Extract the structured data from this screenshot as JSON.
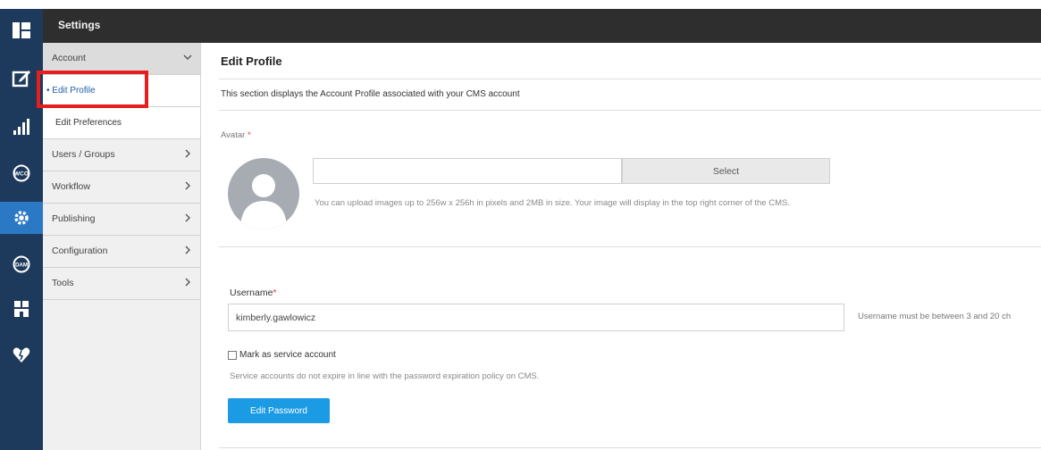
{
  "header": {
    "title": "Settings"
  },
  "rail": {
    "icons": [
      "dashboard-icon",
      "edit-icon",
      "analytics-icon",
      "wco-icon",
      "settings-icon",
      "dam-icon",
      "store-icon",
      "heart-icon"
    ],
    "active": "settings-icon",
    "wco_text": "WCO",
    "dam_text": "DAM"
  },
  "sidebar": {
    "account": "Account",
    "edit_profile": "Edit Profile",
    "edit_preferences": "Edit Preferences",
    "users_groups": "Users / Groups",
    "workflow": "Workflow",
    "publishing": "Publishing",
    "configuration": "Configuration",
    "tools": "Tools"
  },
  "main": {
    "title": "Edit Profile",
    "description": "This section displays the Account Profile associated with your CMS account",
    "avatar_label": "Avatar",
    "required_mark": "*",
    "select_button": "Select",
    "upload_help": "You can upload images up to 256w x 256h in pixels and 2MB in size. Your image will display in the top right corner of the CMS.",
    "username_label": "Username",
    "username_value": "kimberly.gawlowicz",
    "username_hint": "Username must be between 3 and 20 ch",
    "service_account_label": "Mark as service account",
    "service_account_help": "Service accounts do not expire in line with the password expiration policy on CMS.",
    "edit_password_button": "Edit Password"
  },
  "colors": {
    "rail_bg": "#1d3a5c",
    "rail_active": "#2b78c5",
    "header_bg": "#2e2e2e",
    "highlight_box": "#e61e1e",
    "primary_button": "#1a9be3"
  }
}
